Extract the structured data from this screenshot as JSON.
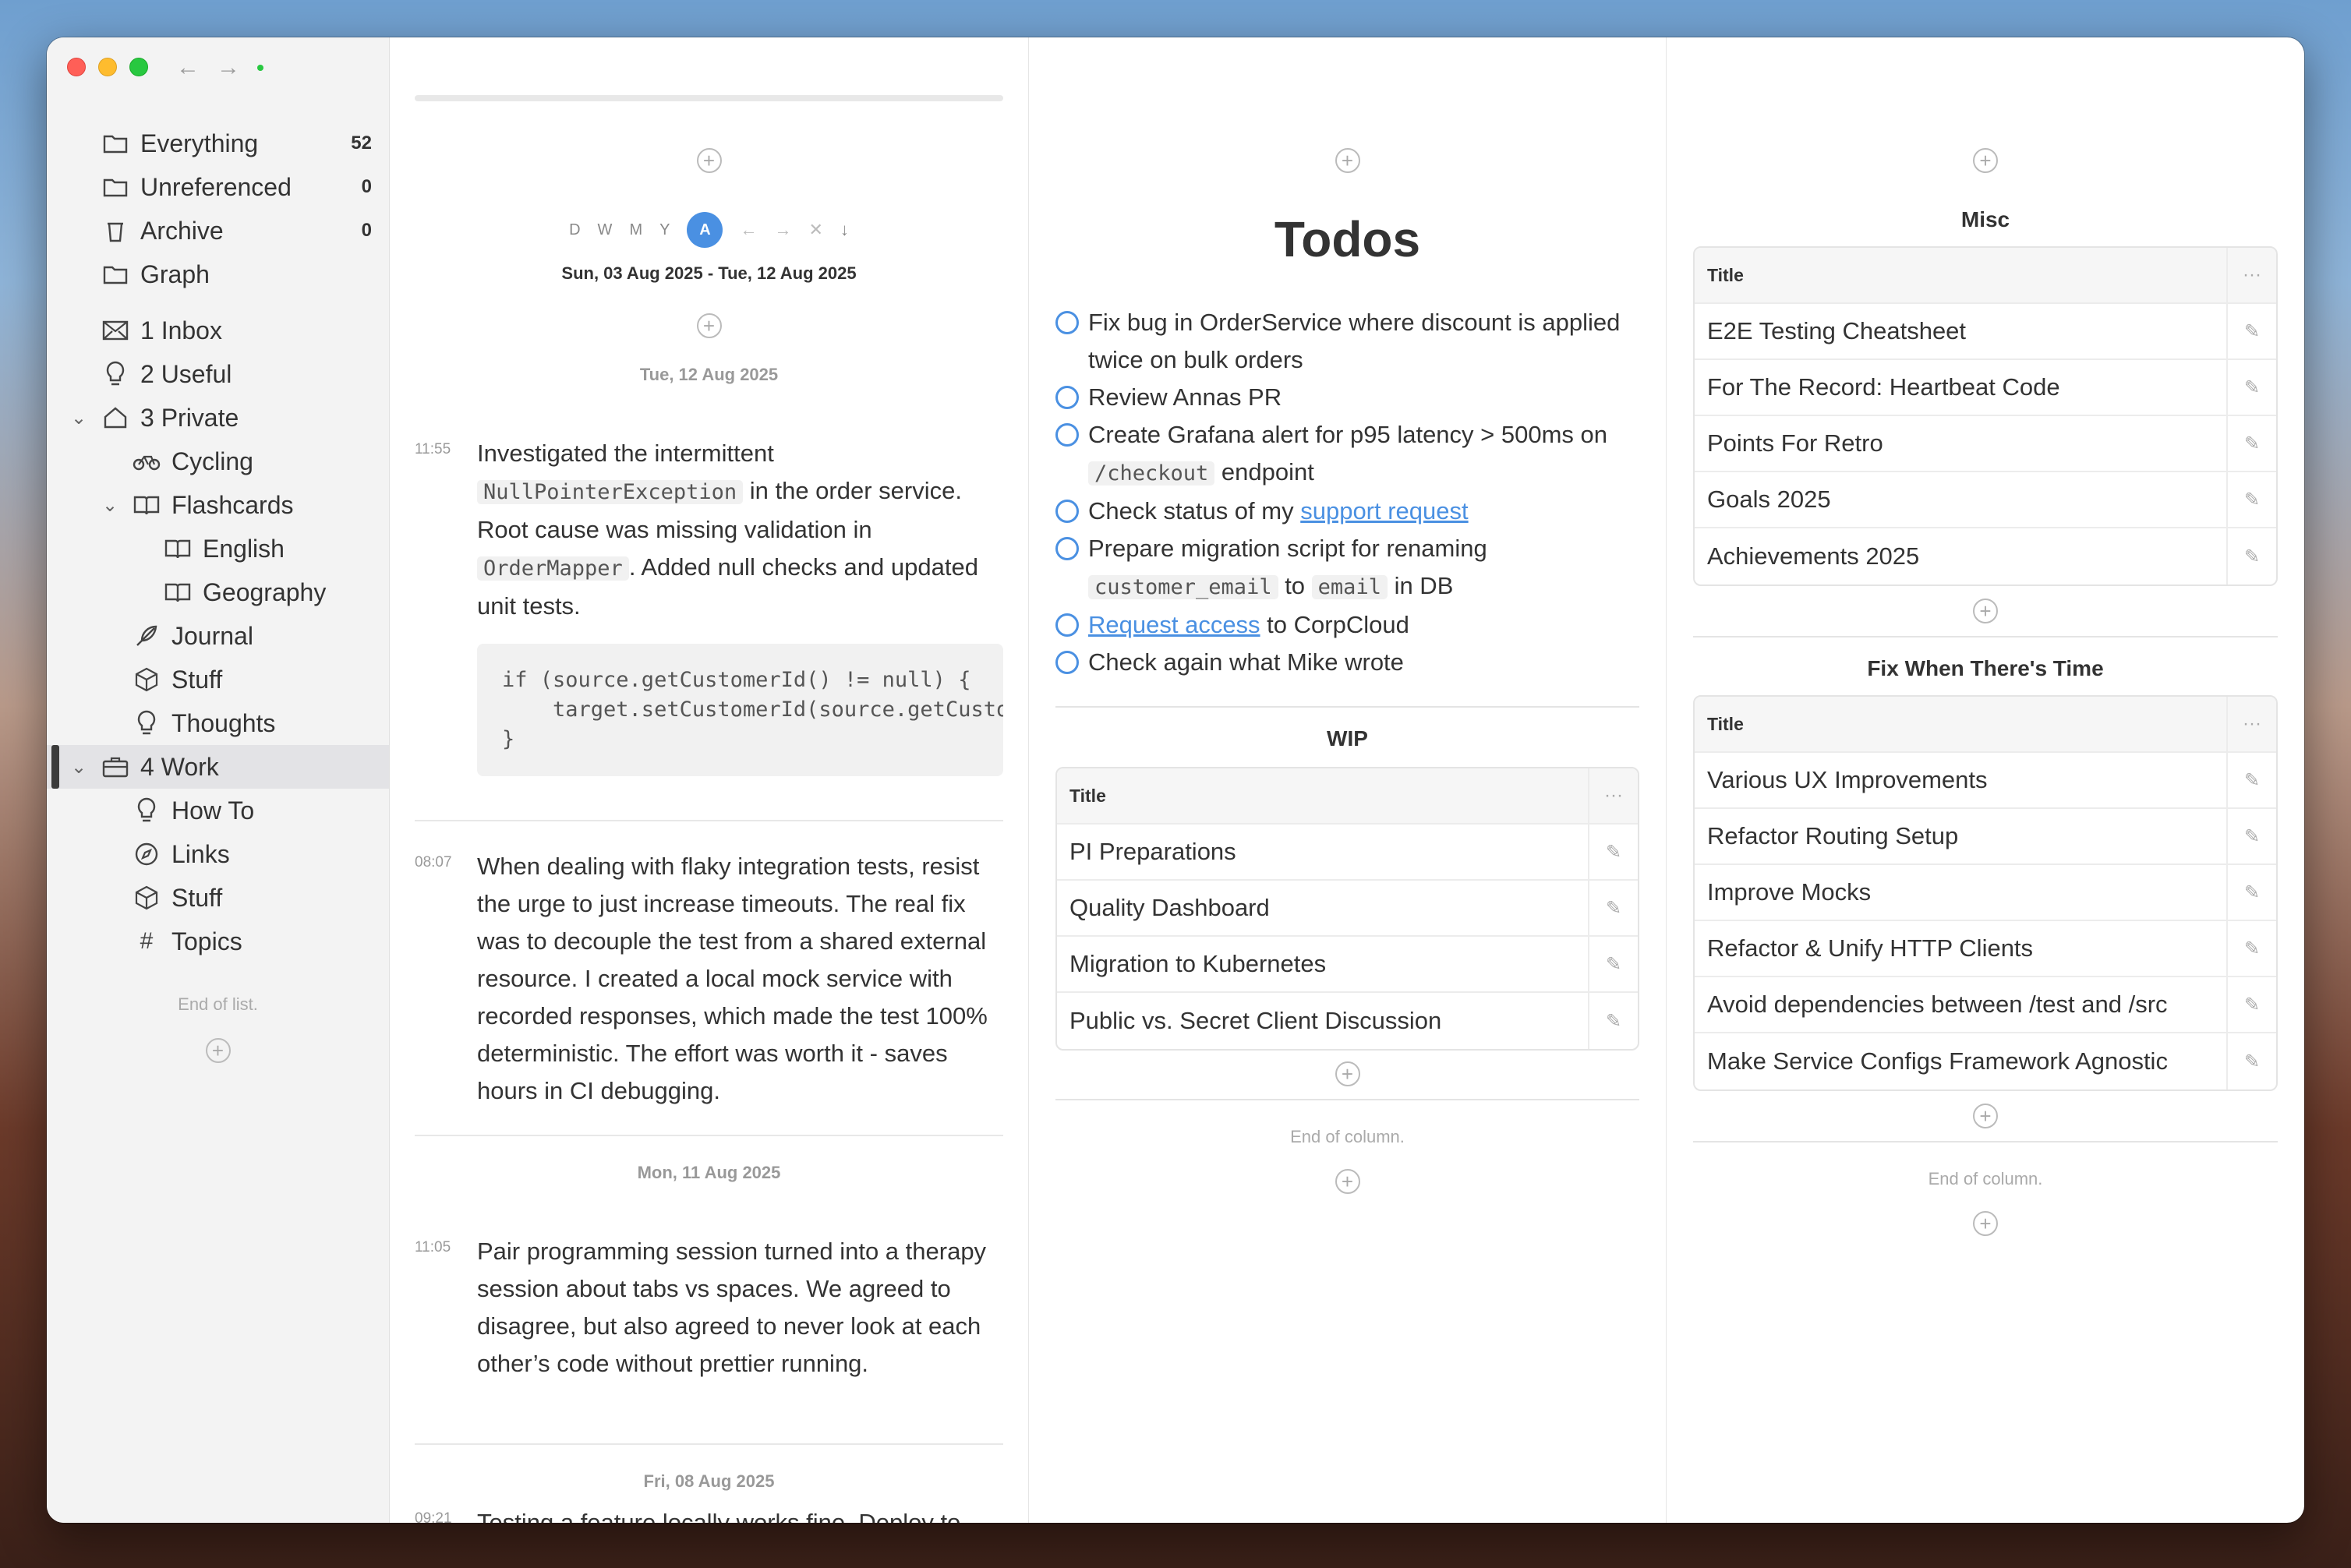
{
  "sidebar": {
    "items": [
      {
        "label": "Everything",
        "count": "52",
        "icon": "folder-icon"
      },
      {
        "label": "Unreferenced",
        "count": "0",
        "icon": "folder-icon"
      },
      {
        "label": "Archive",
        "count": "0",
        "icon": "trash-icon"
      },
      {
        "label": "Graph",
        "count": "",
        "icon": "folder-icon"
      },
      {
        "label": "1 Inbox",
        "icon": "inbox-icon"
      },
      {
        "label": "2 Useful",
        "icon": "lightbulb-icon"
      },
      {
        "label": "3 Private",
        "icon": "home-icon"
      },
      {
        "label": "Cycling",
        "icon": "bicycle-icon"
      },
      {
        "label": "Flashcards",
        "icon": "book-icon"
      },
      {
        "label": "English",
        "icon": "book-icon"
      },
      {
        "label": "Geography",
        "icon": "book-icon"
      },
      {
        "label": "Journal",
        "icon": "feather-icon"
      },
      {
        "label": "Stuff",
        "icon": "box-icon"
      },
      {
        "label": "Thoughts",
        "icon": "lightbulb-icon"
      },
      {
        "label": "4 Work",
        "icon": "briefcase-icon"
      },
      {
        "label": "How To",
        "icon": "lightbulb-icon"
      },
      {
        "label": "Links",
        "icon": "compass-icon"
      },
      {
        "label": "Stuff",
        "icon": "box-icon"
      },
      {
        "label": "Topics",
        "icon": "hash-icon"
      }
    ],
    "end_text": "End of list."
  },
  "journal": {
    "range_buttons": [
      "D",
      "W",
      "M",
      "Y",
      "A"
    ],
    "date_range": "Sun, 03 Aug 2025 - Tue, 12 Aug 2025",
    "days": [
      {
        "date": "Tue, 12 Aug 2025"
      },
      {
        "date": "Mon, 11 Aug 2025"
      },
      {
        "date": "Fri, 08 Aug 2025"
      }
    ],
    "entries": [
      {
        "time": "11:55",
        "t1": "Investigated the intermittent ",
        "code1": "NullPointerException",
        "t2": " in the order service. Root cause was missing validation in ",
        "code2": "OrderMapper",
        "t3": ". Added null checks and updated unit tests.",
        "codeblock": "if (source.getCustomerId() != null) {\n    target.setCustomerId(source.getCustomerId());\n}"
      },
      {
        "time": "08:07",
        "text": "When dealing with flaky integration tests, resist the urge to just increase timeouts. The real fix was to decouple the test from a shared external resource. I created a local mock service with recorded responses, which made the test 100% deterministic. The effort was worth it - saves hours in CI debugging."
      },
      {
        "time": "11:05",
        "text": "Pair programming session turned into a therapy session about tabs vs spaces. We agreed to disagree, but also agreed to never look at each other’s code without prettier running."
      },
      {
        "time": "09:21",
        "text": "Testing a feature locally works fine. Deploy to"
      }
    ]
  },
  "todos": {
    "title": "Todos",
    "items": [
      {
        "text": "Fix bug in OrderService where discount is applied twice on bulk orders"
      },
      {
        "text": "Review Annas PR"
      },
      {
        "t1": "Create Grafana alert for p95 latency > 500ms on ",
        "code": "/checkout",
        "t2": " endpoint"
      },
      {
        "t1": "Check status of my ",
        "link": "support request"
      },
      {
        "t1": "Prepare migration script for renaming ",
        "code1": "customer_email",
        "mid": " to ",
        "code2": "email",
        "t2": " in DB"
      },
      {
        "link": "Request access",
        "t2": " to CorpCloud"
      },
      {
        "text": "Check again what Mike wrote"
      }
    ],
    "wip": {
      "title": "WIP",
      "header": "Title",
      "rows": [
        "PI Preparations",
        "Quality Dashboard",
        "Migration to Kubernetes",
        "Public vs. Secret Client Discussion"
      ]
    },
    "end_text": "End of column."
  },
  "right": {
    "misc": {
      "title": "Misc",
      "header": "Title",
      "rows": [
        "E2E Testing Cheatsheet",
        "For The Record: Heartbeat Code",
        "Points For Retro",
        "Goals 2025",
        "Achievements 2025"
      ]
    },
    "fix": {
      "title": "Fix When There's Time",
      "header": "Title",
      "rows": [
        "Various UX Improvements",
        "Refactor Routing Setup",
        "Improve Mocks",
        "Refactor & Unify HTTP Clients",
        "Avoid dependencies between /test and /src",
        "Make Service Configs Framework Agnostic"
      ]
    },
    "end_text": "End of column."
  },
  "colors": {
    "accent": "#4a90e2",
    "sidebar_bg": "#f3f3f3"
  }
}
